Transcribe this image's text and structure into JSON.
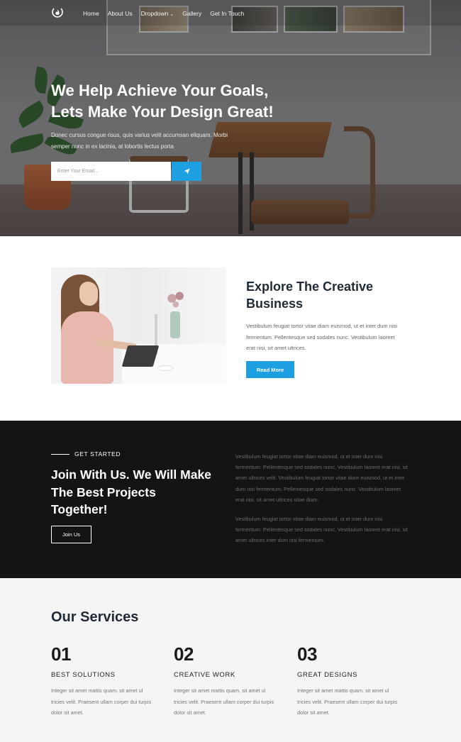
{
  "nav": {
    "links": [
      "Home",
      "About Us",
      "Dropdown",
      "Gallery",
      "Get In Touch"
    ]
  },
  "hero": {
    "title_line1": "We Help Achieve Your Goals,",
    "title_line2": "Lets Make Your Design Great!",
    "subtitle": "Donec cursus congue risus, quis varius velit accumsan eliquam. Morbi semper nunc in ex lacinia, at lobortis lectus porta",
    "email_placeholder": "Enter Your Email..."
  },
  "about": {
    "title": "Explore The Creative Business",
    "text": "Vestibulum feugiat tortor vitae diam euismod, ut et inter dum nisi fermentum. Pellentesque sed sodales nunc. Vestibulum laoreet erat nisi, sit amet ultrices.",
    "button": "Read More"
  },
  "join": {
    "kicker": "GET STARTED",
    "title": "Join With Us. We Will Make The Best Projects Together!",
    "button": "Join Us",
    "paragraph1": "Vestibulum feugiat tortor vitae diam euismod, ut et inter dum nisi fermentum. Pellentesque sed sodales nunc. Vestibulum laoreet erat nisi, sit amet ultrices velit. Vestibulum feugiat tortor vitae diam euismod, ut et inter dum nisi fermentum. Pellentesque sed sodales nunc. Vestibulum laoreet erat nisi, sit amet ultrices vitae diam.",
    "paragraph2": "Vestibulum feugiat tortor vitae diam euismod, ut et inter dum nisi fermentum. Pellentesque sed sodales nunc. Vestibulum laoreet erat nisi, sit amet ultrices inter dum nisi fermentum."
  },
  "services": {
    "title": "Our Services",
    "items": [
      {
        "number": "01",
        "name": "BEST SOLUTIONS",
        "text": "Integer sit amet mattis quam, sit amet ul tricies velit. Praesent ullam corper dui turpis dolor sit amet."
      },
      {
        "number": "02",
        "name": "CREATIVE WORK",
        "text": "Integer sit amet mattis quam, sit amet ul tricies velit. Praesent ullam corper dui turpis dolor sit amet."
      },
      {
        "number": "03",
        "name": "GREAT DESIGNS",
        "text": "Integer sit amet mattis quam, sit amet ul tricies velit. Praesent ullam corper dui turpis dolor sit amet."
      }
    ]
  },
  "colors": {
    "accent": "#1e9fe2",
    "dark": "#141414",
    "heading": "#1f2a36"
  },
  "icons": {
    "logo": "flame-logo-icon",
    "send": "paper-plane-icon",
    "dropdown": "chevron-down-icon"
  }
}
